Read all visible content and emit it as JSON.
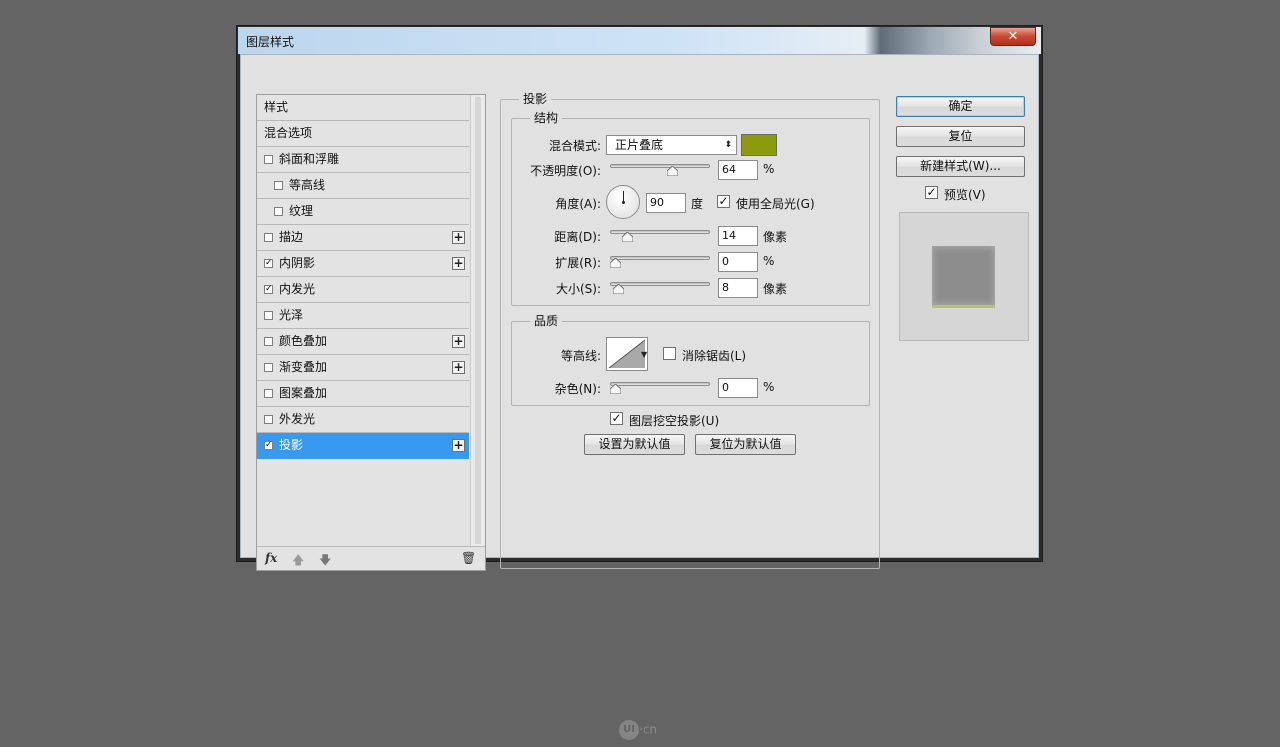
{
  "window": {
    "title": "图层样式",
    "close_glyph": "✕"
  },
  "style_list": {
    "items": [
      {
        "label": "样式",
        "has_checkbox": false,
        "checked": false,
        "has_plus": false,
        "selected": false,
        "indent": 0
      },
      {
        "label": "混合选项",
        "has_checkbox": false,
        "checked": false,
        "has_plus": false,
        "selected": false,
        "indent": 0
      },
      {
        "label": "斜面和浮雕",
        "has_checkbox": true,
        "checked": false,
        "has_plus": false,
        "selected": false,
        "indent": 0
      },
      {
        "label": "等高线",
        "has_checkbox": true,
        "checked": false,
        "has_plus": false,
        "selected": false,
        "indent": 1
      },
      {
        "label": "纹理",
        "has_checkbox": true,
        "checked": false,
        "has_plus": false,
        "selected": false,
        "indent": 1
      },
      {
        "label": "描边",
        "has_checkbox": true,
        "checked": false,
        "has_plus": true,
        "selected": false,
        "indent": 0
      },
      {
        "label": "内阴影",
        "has_checkbox": true,
        "checked": true,
        "has_plus": true,
        "selected": false,
        "indent": 0
      },
      {
        "label": "内发光",
        "has_checkbox": true,
        "checked": true,
        "has_plus": false,
        "selected": false,
        "indent": 0
      },
      {
        "label": "光泽",
        "has_checkbox": true,
        "checked": false,
        "has_plus": false,
        "selected": false,
        "indent": 0
      },
      {
        "label": "颜色叠加",
        "has_checkbox": true,
        "checked": false,
        "has_plus": true,
        "selected": false,
        "indent": 0
      },
      {
        "label": "渐变叠加",
        "has_checkbox": true,
        "checked": false,
        "has_plus": true,
        "selected": false,
        "indent": 0
      },
      {
        "label": "图案叠加",
        "has_checkbox": true,
        "checked": false,
        "has_plus": false,
        "selected": false,
        "indent": 0
      },
      {
        "label": "外发光",
        "has_checkbox": true,
        "checked": false,
        "has_plus": false,
        "selected": false,
        "indent": 0
      },
      {
        "label": "投影",
        "has_checkbox": true,
        "checked": true,
        "has_plus": true,
        "selected": true,
        "indent": 0
      }
    ],
    "footer": {
      "fx_label": "fx",
      "up_glyph": "🡅",
      "down_glyph": "🡇",
      "trash_glyph": "🗑"
    }
  },
  "drop_shadow": {
    "section_title": "投影",
    "structure": {
      "title": "结构",
      "blend_mode_label": "混合模式:",
      "blend_mode_value": "正片叠底",
      "color": "#8c9a0d",
      "opacity_label": "不透明度(O):",
      "opacity_value": "64",
      "opacity_unit": "%",
      "angle_label": "角度(A):",
      "angle_value": "90",
      "angle_unit": "度",
      "global_light_label": "使用全局光(G)",
      "global_light_checked": true,
      "distance_label": "距离(D):",
      "distance_value": "14",
      "distance_unit": "像素",
      "spread_label": "扩展(R):",
      "spread_value": "0",
      "spread_unit": "%",
      "size_label": "大小(S):",
      "size_value": "8",
      "size_unit": "像素"
    },
    "quality": {
      "title": "品质",
      "contour_label": "等高线:",
      "antialias_label": "消除锯齿(L)",
      "antialias_checked": false,
      "noise_label": "杂色(N):",
      "noise_value": "0",
      "noise_unit": "%"
    },
    "knockout_label": "图层挖空投影(U)",
    "knockout_checked": true,
    "make_default_label": "设置为默认值",
    "reset_default_label": "复位为默认值"
  },
  "buttons": {
    "ok": "确定",
    "reset": "复位",
    "new_style": "新建样式(W)..."
  },
  "preview": {
    "label": "预览(V)",
    "checked": true
  },
  "watermark": {
    "logo_text": "UI",
    "suffix": "·cn"
  }
}
